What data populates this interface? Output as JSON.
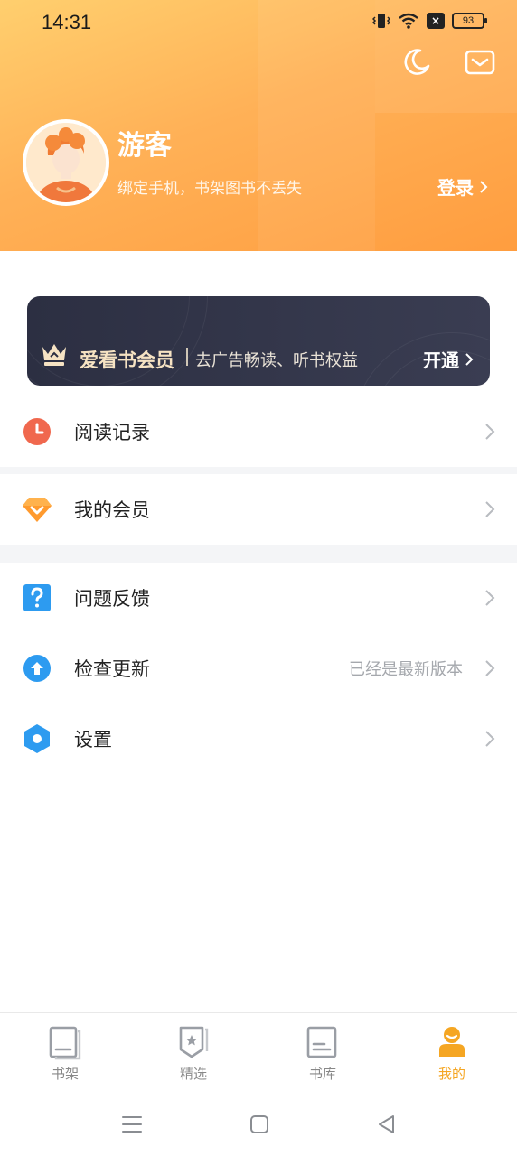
{
  "status_bar": {
    "time": "14:31",
    "battery": "93"
  },
  "profile": {
    "username": "游客",
    "subtitle": "绑定手机，书架图书不丢失",
    "login_label": "登录"
  },
  "vip": {
    "title": "爱看书会员",
    "description": "去广告畅读、听书权益",
    "action": "开通"
  },
  "menu": [
    {
      "label": "阅读记录",
      "icon": "clock-icon",
      "color": "#f0684e"
    },
    {
      "label": "我的会员",
      "icon": "diamond-icon",
      "color": "#ff9a2e"
    },
    {
      "label": "问题反馈",
      "icon": "question-icon",
      "color": "#2d9bf0"
    },
    {
      "label": "检查更新",
      "icon": "upload-arrow-icon",
      "color": "#2d9bf0",
      "value": "已经是最新版本"
    },
    {
      "label": "设置",
      "icon": "hexagon-icon",
      "color": "#2d9bf0"
    }
  ],
  "bottom_nav": [
    {
      "label": "书架",
      "icon": "bookshelf-icon"
    },
    {
      "label": "精选",
      "icon": "featured-icon"
    },
    {
      "label": "书库",
      "icon": "library-icon"
    },
    {
      "label": "我的",
      "icon": "profile-icon",
      "active": true
    }
  ],
  "colors": {
    "accent": "#f5a623",
    "header_start": "#ffcf6e",
    "header_end": "#ff9d3f",
    "vip_bg": "#2c2f42"
  }
}
